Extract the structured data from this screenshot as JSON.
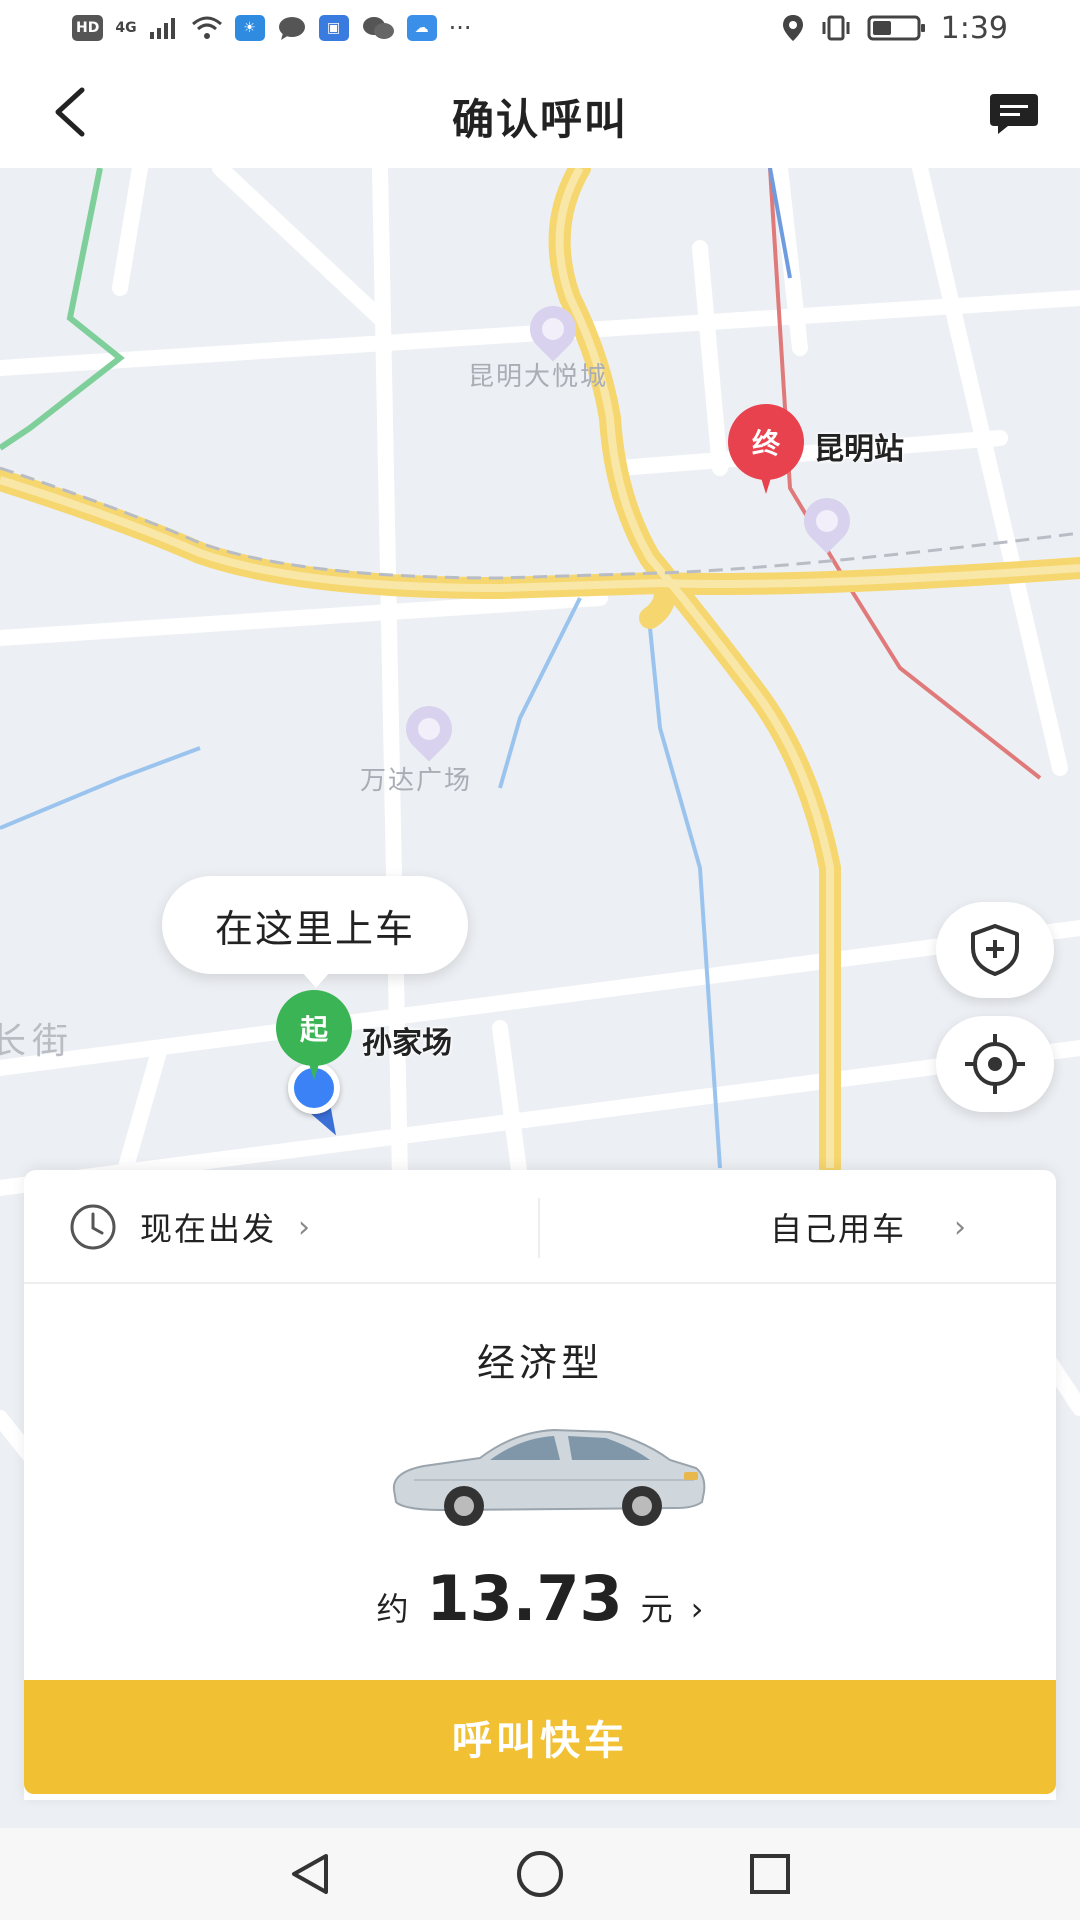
{
  "status_bar": {
    "time": "1:39",
    "network_label": "4G",
    "hd_label": "HD",
    "more_label": "···",
    "icons": [
      "signal-icon",
      "wifi-icon",
      "weather-icon",
      "chat-icon",
      "app-icon",
      "wechat-icon",
      "cloud-icon",
      "location-icon",
      "vibrate-icon",
      "battery-icon"
    ]
  },
  "header": {
    "title": "确认呼叫",
    "back_icon": "back-arrow-icon",
    "message_icon": "message-icon"
  },
  "map": {
    "pois": [
      "昆明大悦城",
      "昆明站",
      "万达广场"
    ],
    "street_label": "长街",
    "end_marker": {
      "label": "终",
      "place": "昆明站",
      "color": "#e8424e"
    },
    "start_marker": {
      "label": "起",
      "place": "孙家场",
      "color": "#3bb456"
    },
    "pickup_bubble": "在这里上车",
    "buttons": [
      "shield-plus-icon",
      "locate-icon"
    ]
  },
  "trip_options": {
    "departure": "现在出发",
    "rider": "自己用车"
  },
  "car": {
    "type": "经济型",
    "price_prefix": "约",
    "price": "13.73",
    "price_unit": "元"
  },
  "call_button": "呼叫快车",
  "colors": {
    "accent": "#f2c033",
    "road_major": "#f6d66e",
    "map_bg": "#eceff3",
    "start_green": "#3bb456",
    "end_red": "#e8424e",
    "location_blue": "#3b82f6"
  },
  "nav_bar": {
    "buttons": [
      "back-triangle-icon",
      "home-circle-icon",
      "recents-square-icon"
    ]
  }
}
